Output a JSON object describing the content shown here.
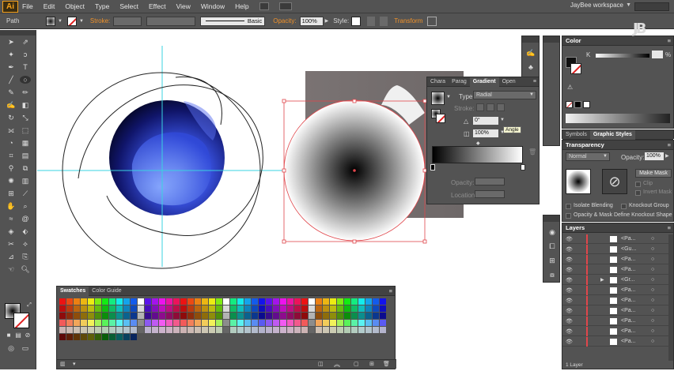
{
  "app": {
    "logo": "Ai",
    "workspace": "JayBee workspace"
  },
  "menu": [
    "File",
    "Edit",
    "Object",
    "Type",
    "Select",
    "Effect",
    "View",
    "Window",
    "Help"
  ],
  "control_bar": {
    "selection": "Path",
    "stroke_label": "Stroke:",
    "brush_label": "Basic",
    "opacity_label": "Opacity:",
    "opacity_value": "100%",
    "style_label": "Style:",
    "transform_label": "Transform"
  },
  "color_panel": {
    "title": "Color",
    "channel": "K",
    "value": "%"
  },
  "gradient_panel": {
    "tabs": [
      "Chara",
      "Parag",
      "Gradient",
      "Open"
    ],
    "type_label": "Type:",
    "type_value": "Radial",
    "stroke_label": "Stroke:",
    "angle_value": "0°",
    "aspect_value": "100%",
    "tooltip": "Angle",
    "opacity_label": "Opacity:",
    "location_label": "Location:"
  },
  "symbols_panel": {
    "tabs": [
      "Symbols",
      "Graphic Styles"
    ]
  },
  "transparency_panel": {
    "title": "Transparency",
    "blend_mode": "Normal",
    "opacity_label": "Opacity:",
    "opacity_value": "100%",
    "make_mask": "Make Mask",
    "clip": "Clip",
    "invert_mask": "Invert Mask",
    "isolate_blending": "Isolate Blending",
    "knockout_group": "Knockout Group",
    "opacity_mask_define": "Opacity & Mask Define Knockout Shape"
  },
  "layers_panel": {
    "title": "Layers",
    "rows": [
      "<Pa...",
      "<Gu...",
      "<Pa...",
      "<Pa...",
      "<Gr...",
      "<Pa...",
      "<Pa...",
      "<Pa...",
      "<Pa...",
      "<Pa...",
      "<Pa..."
    ],
    "footer": "1 Layer"
  },
  "swatches_panel": {
    "tabs": [
      "Swatches",
      "Color Guide"
    ]
  },
  "colors": {
    "ui": "#535353",
    "accent": "#f1922a",
    "selection": "#e0464b",
    "guide": "#39d3e0"
  }
}
